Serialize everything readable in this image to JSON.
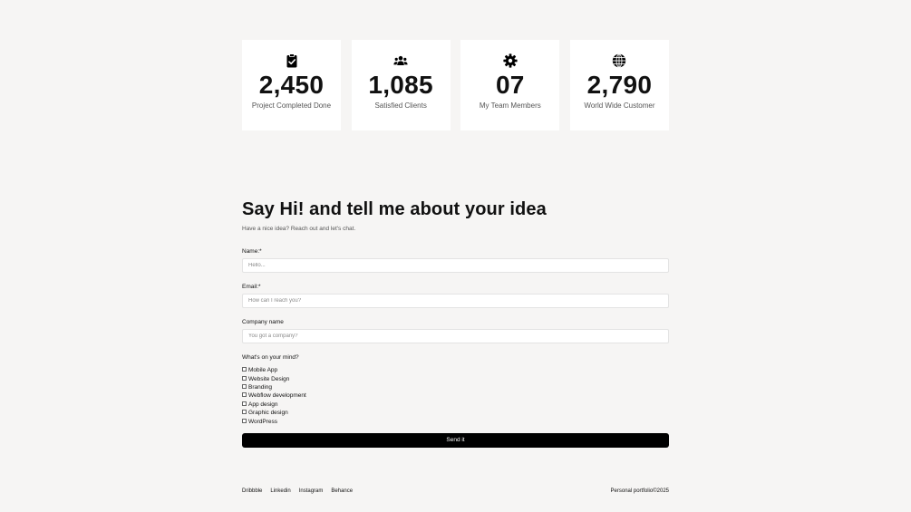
{
  "stats": [
    {
      "icon": "clipboard-check-icon",
      "value": "2,450",
      "label": "Project Completed Done"
    },
    {
      "icon": "users-icon",
      "value": "1,085",
      "label": "Satisfied Clients"
    },
    {
      "icon": "gear-icon",
      "value": "07",
      "label": "My Team Members"
    },
    {
      "icon": "globe-icon",
      "value": "2,790",
      "label": "World Wide Customer"
    }
  ],
  "contact": {
    "title": "Say Hi! and tell me about your idea",
    "subtitle": "Have a nice idea? Reach out and let's chat.",
    "name_label": "Name:*",
    "name_placeholder": "Hello...",
    "email_label": "Email:*",
    "email_placeholder": "How can I reach you?",
    "company_label": "Company name",
    "company_placeholder": "You got a company?",
    "mind_label": "What's on your mind?",
    "options": [
      "Mobile App",
      "Website Design",
      "Branding",
      "Webflow development",
      "App design",
      "Graphic design",
      "WordPress"
    ],
    "submit_label": "Send it"
  },
  "footer": {
    "links": [
      "Dribbble",
      "Linkedin",
      "Instagram",
      "Behance"
    ],
    "copyright": "Personal portfolio©2025"
  }
}
